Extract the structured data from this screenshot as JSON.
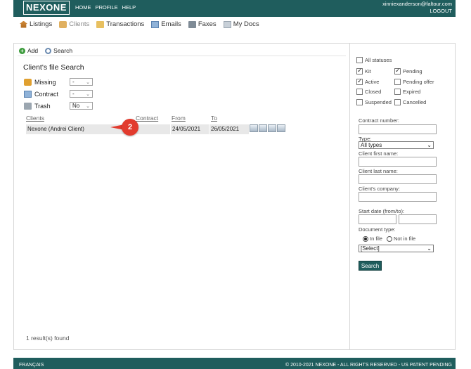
{
  "header": {
    "logo": "NEXONE",
    "nav": [
      "HOME",
      "PROFILE",
      "HELP"
    ],
    "user_email": "xinniexanderson@faltour.com",
    "logout": "LOGOUT"
  },
  "subnav": {
    "items": [
      {
        "label": "Listings",
        "icon": "house-icon"
      },
      {
        "label": "Clients",
        "icon": "clients-icon",
        "active": true
      },
      {
        "label": "Transactions",
        "icon": "folder-icon"
      },
      {
        "label": "Emails",
        "icon": "mail-icon"
      },
      {
        "label": "Faxes",
        "icon": "fax-icon"
      },
      {
        "label": "My Docs",
        "icon": "docs-icon"
      }
    ]
  },
  "toolbar": {
    "add": "Add",
    "search": "Search"
  },
  "page_title": "Client's file Search",
  "filters": {
    "missing": {
      "label": "Missing",
      "value": "-"
    },
    "contract": {
      "label": "Contract",
      "value": "-"
    },
    "trash": {
      "label": "Trash",
      "value": "No"
    }
  },
  "table": {
    "headers": {
      "clients": "Clients",
      "contract": "Contract",
      "from": "From",
      "to": "To"
    },
    "rows": [
      {
        "client": "Nexone (Andrei Client)",
        "contract": "",
        "from": "24/05/2021",
        "to": "26/05/2021"
      }
    ]
  },
  "annotation_badge": "2",
  "results": "1 result(s) found",
  "side": {
    "statuses": {
      "all": "All statuses",
      "kit": "Kit",
      "pending": "Pending",
      "active": "Active",
      "pending_offer": "Pending offer",
      "closed": "Closed",
      "expired": "Expired",
      "suspended": "Suspended",
      "cancelled": "Cancelled"
    },
    "contract_number": "Contract number:",
    "type_label": "Type:",
    "type_value": "All types",
    "first_name": "Client first name:",
    "last_name": "Client last name:",
    "company": "Client's company:",
    "start_date": "Start date (from/to):",
    "doc_type": "Document type:",
    "in_file": "In file",
    "not_in_file": "Not in file",
    "select_value": "[Select]",
    "search_button": "Search"
  },
  "footer": {
    "lang": "FRANÇAIS",
    "copyright": "© 2010-2021 NEXONE - ALL RIGHTS RESERVED - US PATENT PENDING"
  },
  "colors": {
    "brand": "#1f5d5d",
    "badge": "#e23b2e"
  }
}
